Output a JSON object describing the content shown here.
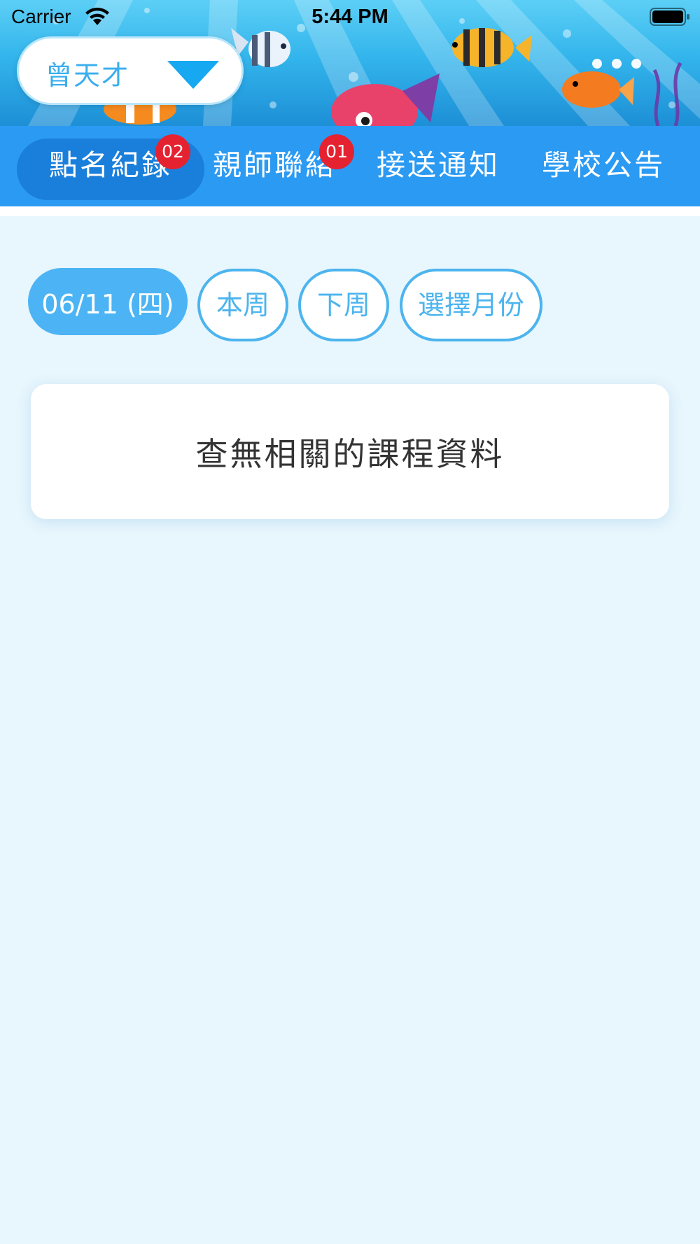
{
  "status_bar": {
    "carrier": "Carrier",
    "time": "5:44 PM",
    "icons": [
      "wifi-icon",
      "battery-icon"
    ]
  },
  "header": {
    "student_name": "曾天才",
    "dropdown_icon": "triangle-down-icon",
    "page_dots_count": 3,
    "banner_icon": "underwater-fish-illustration"
  },
  "tabs": [
    {
      "label": "點名紀錄",
      "badge": "02",
      "active": true
    },
    {
      "label": "親師聯絡",
      "badge": "01",
      "active": false
    },
    {
      "label": "接送通知",
      "badge": "",
      "active": false
    },
    {
      "label": "學校公告",
      "badge": "",
      "active": false
    }
  ],
  "filters": [
    {
      "label": "06/11 (四)",
      "selected": true
    },
    {
      "label": "本周",
      "selected": false
    },
    {
      "label": "下周",
      "selected": false
    },
    {
      "label": "選擇月份",
      "selected": false
    }
  ],
  "content": {
    "empty_message": "查無相關的課程資料"
  },
  "colors": {
    "tab_bar": "#2b9af3",
    "tab_active": "#1a7fdb",
    "badge": "#e52230",
    "accent": "#4cb4ee",
    "page_background": "#e8f6fd"
  }
}
